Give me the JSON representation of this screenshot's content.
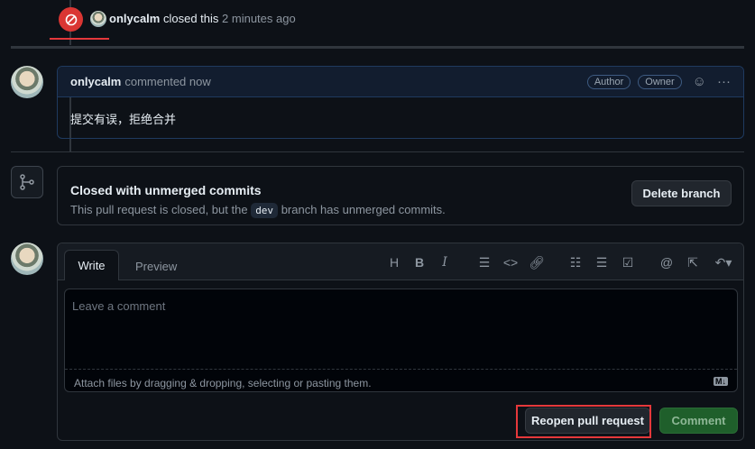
{
  "event": {
    "user": "onlycalm",
    "action": "closed this",
    "time": "2 minutes ago"
  },
  "comment": {
    "user": "onlycalm",
    "action": "commented now",
    "badges": [
      "Author",
      "Owner"
    ],
    "body": "提交有误，拒绝合并"
  },
  "branch_notice": {
    "title": "Closed with unmerged commits",
    "text_before": "This pull request is closed, but the",
    "branch": "dev",
    "text_after": "branch has unmerged commits.",
    "delete_button": "Delete branch"
  },
  "editor": {
    "tabs": [
      "Write",
      "Preview"
    ],
    "placeholder": "Leave a comment",
    "attach_hint": "Attach files by dragging & dropping, selecting or pasting them.",
    "reopen_button": "Reopen pull request",
    "comment_button": "Comment"
  },
  "colors": {
    "closed": "#da3633",
    "comment_green": "#238636",
    "highlight": "#e5383b"
  }
}
